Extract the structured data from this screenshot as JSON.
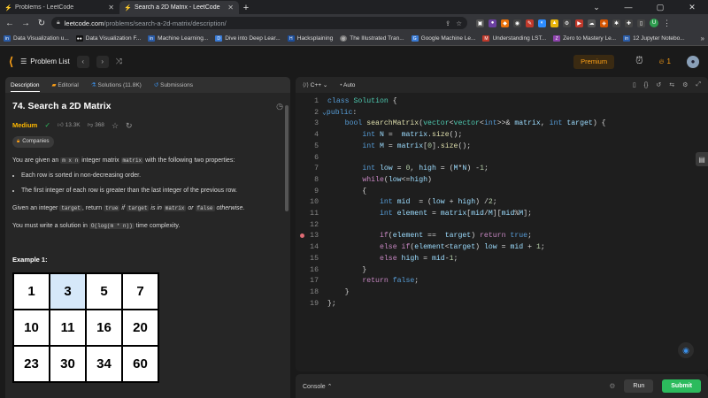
{
  "browser": {
    "tabs": [
      {
        "title": "Problems - LeetCode",
        "active": false
      },
      {
        "title": "Search a 2D Matrix - LeetCode",
        "active": true
      }
    ],
    "url_domain": "leetcode.com",
    "url_path": "/problems/search-a-2d-matrix/description/",
    "bookmarks": [
      "Data Visualization u...",
      "Data Visualization F...",
      "Machine Learning...",
      "Dive into Deep Lear...",
      "Hacksplaining",
      "The Illustrated Tran...",
      "Google Machine Le...",
      "Understanding LST...",
      "Zero to Mastery Le...",
      "12 Jupyter Notebo..."
    ],
    "profile_initial": "U"
  },
  "header": {
    "problem_list": "Problem List",
    "premium": "Premium",
    "streak": "1"
  },
  "left": {
    "tabs": [
      "Description",
      "Editorial",
      "Solutions (11.8K)",
      "Submissions"
    ],
    "title": "74. Search a 2D Matrix",
    "difficulty": "Medium",
    "likes": "13.3K",
    "dislikes": "368",
    "companies": "Companies",
    "p1_before": "You are given an ",
    "p1_code1": "m x n",
    "p1_mid": " integer matrix ",
    "p1_code2": "matrix",
    "p1_after": " with the following two properties:",
    "bullet1": "Each row is sorted in non-decreasing order.",
    "bullet2": "The first integer of each row is greater than the last integer of the previous row.",
    "p2_a": "Given an integer ",
    "p2_code1": "target",
    "p2_b": ", return ",
    "p2_code2": "true",
    "p2_c": " if ",
    "p2_code3": "target",
    "p2_d": " is in ",
    "p2_code4": "matrix",
    "p2_e": " or ",
    "p2_code5": "false",
    "p2_f": " otherwise.",
    "p3_a": "You must write a solution in ",
    "p3_code": "O(log(m * n))",
    "p3_b": " time complexity.",
    "example_title": "Example 1:",
    "matrix": [
      [
        "1",
        "3",
        "5",
        "7"
      ],
      [
        "10",
        "11",
        "16",
        "20"
      ],
      [
        "23",
        "30",
        "34",
        "60"
      ]
    ]
  },
  "editor": {
    "language": "C++",
    "mode": "Auto",
    "line_numbers": [
      "1",
      "2",
      "3",
      "4",
      "5",
      "6",
      "7",
      "8",
      "9",
      "10",
      "11",
      "12",
      "13",
      "14",
      "15",
      "16",
      "17",
      "18",
      "19"
    ]
  },
  "console": {
    "label": "Console",
    "run": "Run",
    "submit": "Submit"
  },
  "colors": {
    "accent": "#ffa116",
    "submit": "#2cbb5d",
    "medium": "#ffb800",
    "highlight_cell": "#d6e8f9"
  }
}
